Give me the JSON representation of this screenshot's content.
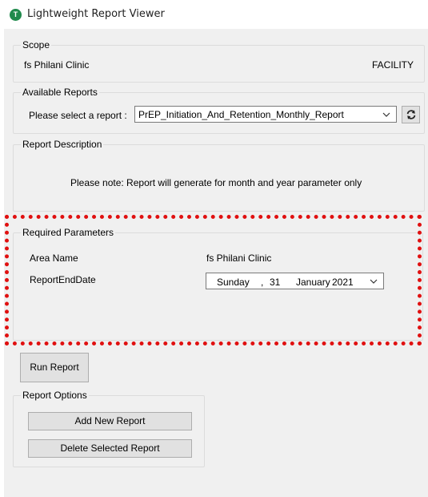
{
  "window": {
    "title": "Lightweight Report Viewer",
    "icon_letter": "T"
  },
  "scope": {
    "legend": "Scope",
    "facility_name": "fs Philani Clinic",
    "level": "FACILITY"
  },
  "available_reports": {
    "legend": "Available Reports",
    "prompt": "Please select a report :",
    "selected": "PrEP_Initiation_And_Retention_Monthly_Report"
  },
  "description": {
    "legend": "Report Description",
    "text": "Please note: Report will generate for month and year parameter only"
  },
  "parameters": {
    "legend": "Required Parameters",
    "area_label": "Area Name",
    "area_value": "fs Philani Clinic",
    "date_label": "ReportEndDate",
    "date_day": "Sunday",
    "date_sep": ",",
    "date_num": "31",
    "date_month": "January",
    "date_year": "2021"
  },
  "run_button": "Run Report",
  "options": {
    "legend": "Report Options",
    "add_label": "Add New Report",
    "delete_label": "Delete Selected Report"
  },
  "colors": {
    "highlight_border": "#e01010",
    "app_icon": "#1f8a4c"
  }
}
